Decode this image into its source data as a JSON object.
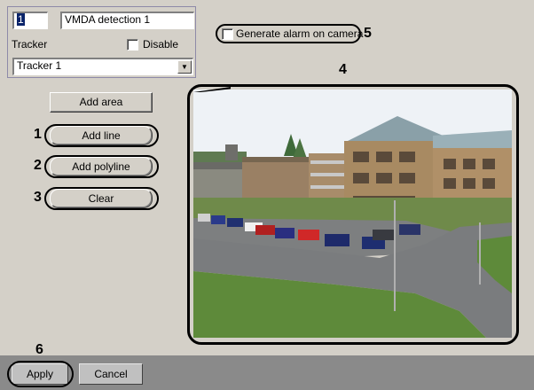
{
  "settings": {
    "id_value": "1",
    "name_value": "VMDA detection 1",
    "tracker_label": "Tracker",
    "disable_label": "Disable",
    "tracker_selected": "Tracker 1"
  },
  "generate_alarm_label": "Generate alarm on camera",
  "buttons": {
    "add_area": "Add area",
    "add_line": "Add line",
    "add_polyline": "Add polyline",
    "clear": "Clear",
    "apply": "Apply",
    "cancel": "Cancel"
  },
  "callouts": [
    "1",
    "2",
    "3",
    "4",
    "5",
    "6"
  ],
  "colors": {
    "panel": "#d4d0c8",
    "selection": "#0a246a",
    "bottom_bar": "#8a8a8a"
  }
}
